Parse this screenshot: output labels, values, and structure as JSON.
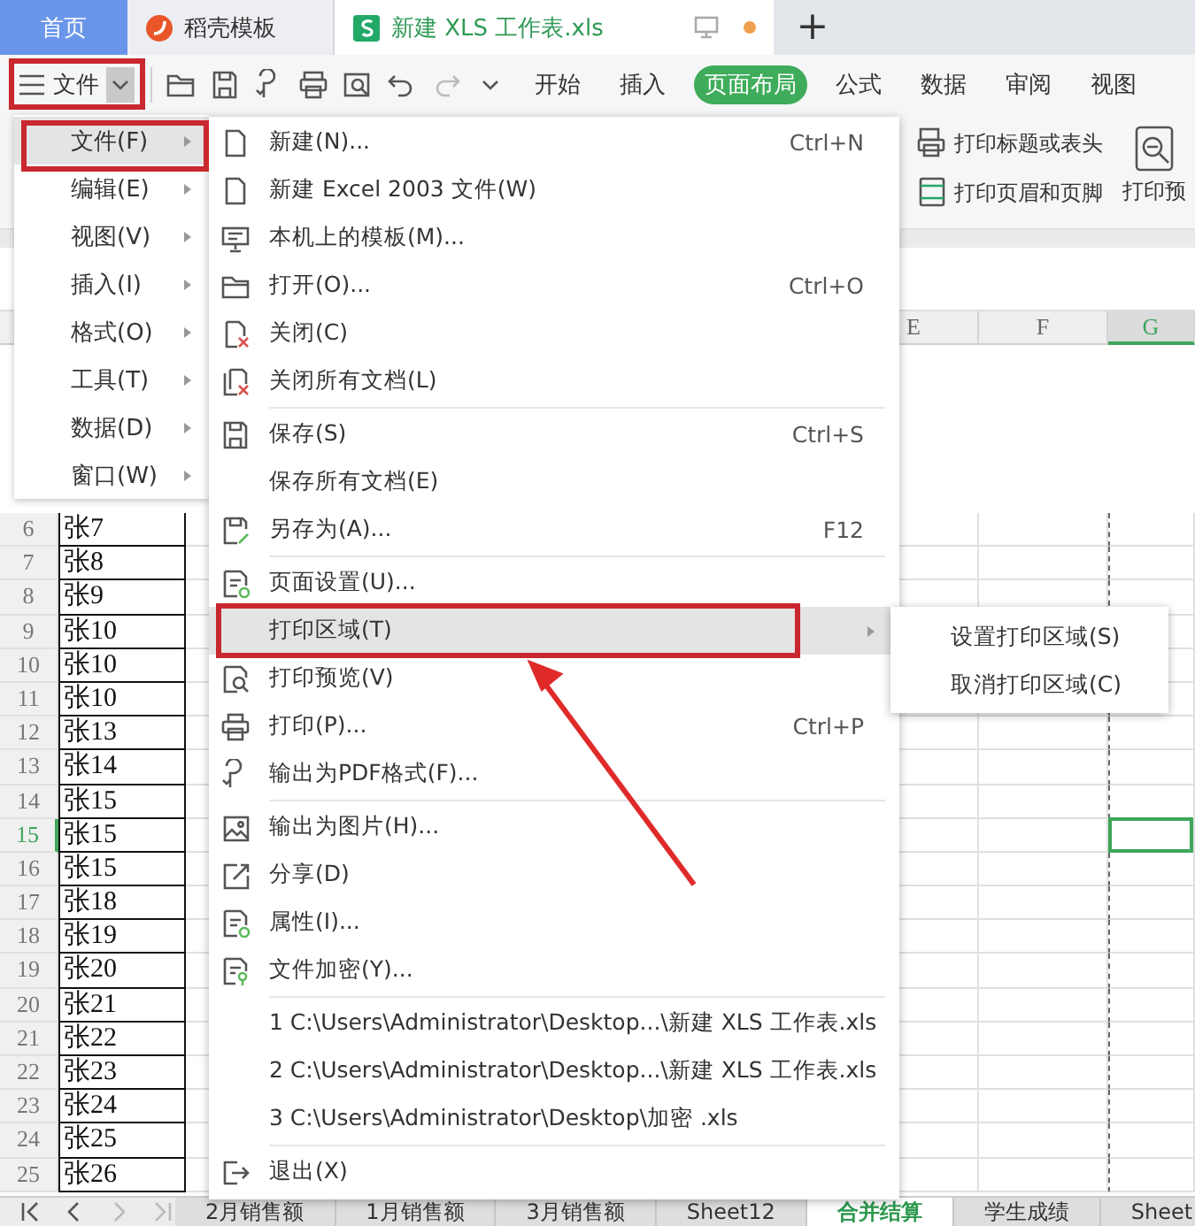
{
  "doc_tabs": [
    {
      "label": "首页",
      "selected": false
    },
    {
      "label": "稻壳模板",
      "selected": false
    },
    {
      "label": "新建 XLS 工作表.xls",
      "selected": true,
      "modified": true
    }
  ],
  "new_tab": "+",
  "file_button": {
    "label": "文件"
  },
  "ribbon_tabs": [
    {
      "label": "开始",
      "selected": false
    },
    {
      "label": "插入",
      "selected": false
    },
    {
      "label": "页面布局",
      "selected": true
    },
    {
      "label": "公式",
      "selected": false
    },
    {
      "label": "数据",
      "selected": false
    },
    {
      "label": "审阅",
      "selected": false
    },
    {
      "label": "视图",
      "selected": false
    }
  ],
  "ribbon": {
    "buttons": [
      {
        "label": "打印标题或表头"
      },
      {
        "label": "打印页眉和页脚"
      }
    ],
    "large_button": {
      "label": "打印预"
    }
  },
  "columns": [
    {
      "label": "E",
      "selected": false
    },
    {
      "label": "F",
      "selected": false
    },
    {
      "label": "G",
      "selected": true
    }
  ],
  "rows": [
    {
      "number": "6",
      "name": "张7",
      "selected": false
    },
    {
      "number": "7",
      "name": "张8",
      "selected": false
    },
    {
      "number": "8",
      "name": "张9",
      "selected": false
    },
    {
      "number": "9",
      "name": "张10",
      "selected": false
    },
    {
      "number": "10",
      "name": "张10",
      "selected": false
    },
    {
      "number": "11",
      "name": "张10",
      "selected": false
    },
    {
      "number": "12",
      "name": "张13",
      "selected": false
    },
    {
      "number": "13",
      "name": "张14",
      "selected": false
    },
    {
      "number": "14",
      "name": "张15",
      "selected": false
    },
    {
      "number": "15",
      "name": "张15",
      "selected": true
    },
    {
      "number": "16",
      "name": "张15",
      "selected": false
    },
    {
      "number": "17",
      "name": "张18",
      "selected": false
    },
    {
      "number": "18",
      "name": "张19",
      "selected": false
    },
    {
      "number": "19",
      "name": "张20",
      "selected": false
    },
    {
      "number": "20",
      "name": "张21",
      "selected": false
    },
    {
      "number": "21",
      "name": "张22",
      "selected": false
    },
    {
      "number": "22",
      "name": "张23",
      "selected": false
    },
    {
      "number": "23",
      "name": "张24",
      "selected": false
    },
    {
      "number": "24",
      "name": "张25",
      "selected": false
    },
    {
      "number": "25",
      "name": "张26",
      "selected": false
    }
  ],
  "sheet_tabs": [
    {
      "label": "2月销售额",
      "selected": false
    },
    {
      "label": "1月销售额",
      "selected": false
    },
    {
      "label": "3月销售额",
      "selected": false
    },
    {
      "label": "Sheet12",
      "selected": false
    },
    {
      "label": "合并结算",
      "selected": true
    },
    {
      "label": "学生成绩",
      "selected": false
    },
    {
      "label": "Sheet",
      "selected": false
    }
  ],
  "left_menu": {
    "items": [
      {
        "label": "文件(F)",
        "selected": true
      },
      {
        "label": "编辑(E)",
        "selected": false
      },
      {
        "label": "视图(V)",
        "selected": false
      },
      {
        "label": "插入(I)",
        "selected": false
      },
      {
        "label": "格式(O)",
        "selected": false
      },
      {
        "label": "工具(T)",
        "selected": false
      },
      {
        "label": "数据(D)",
        "selected": false
      },
      {
        "label": "窗口(W)",
        "selected": false
      }
    ]
  },
  "file_menu": {
    "items": [
      {
        "kind": "command",
        "label": "新建(N)...",
        "shortcut": "Ctrl+N",
        "selected": false
      },
      {
        "kind": "command",
        "label": "新建 Excel 2003 文件(W)",
        "selected": false
      },
      {
        "kind": "command",
        "label": "本机上的模板(M)...",
        "selected": false
      },
      {
        "kind": "command",
        "label": "打开(O)...",
        "shortcut": "Ctrl+O",
        "selected": false
      },
      {
        "kind": "command",
        "label": "关闭(C)",
        "selected": false
      },
      {
        "kind": "command",
        "label": "关闭所有文档(L)",
        "selected": false
      },
      {
        "kind": "separator"
      },
      {
        "kind": "command",
        "label": "保存(S)",
        "shortcut": "Ctrl+S",
        "selected": false
      },
      {
        "kind": "command",
        "label": "保存所有文档(E)",
        "selected": false
      },
      {
        "kind": "command",
        "label": "另存为(A)...",
        "shortcut": "F12",
        "selected": false
      },
      {
        "kind": "separator"
      },
      {
        "kind": "command",
        "label": "页面设置(U)...",
        "selected": false
      },
      {
        "kind": "submenu",
        "label": "打印区域(T)",
        "selected": true
      },
      {
        "kind": "command",
        "label": "打印预览(V)",
        "selected": false
      },
      {
        "kind": "command",
        "label": "打印(P)...",
        "shortcut": "Ctrl+P",
        "selected": false
      },
      {
        "kind": "command",
        "label": "输出为PDF格式(F)...",
        "selected": false
      },
      {
        "kind": "separator"
      },
      {
        "kind": "command",
        "label": "输出为图片(H)...",
        "selected": false
      },
      {
        "kind": "command",
        "label": "分享(D)",
        "selected": false
      },
      {
        "kind": "command",
        "label": "属性(I)...",
        "selected": false
      },
      {
        "kind": "command",
        "label": "文件加密(Y)...",
        "selected": false
      },
      {
        "kind": "separator"
      },
      {
        "kind": "command",
        "label": "1 C:\\Users\\Administrator\\Desktop...\\新建 XLS 工作表.xls",
        "selected": false
      },
      {
        "kind": "command",
        "label": "2 C:\\Users\\Administrator\\Desktop...\\新建 XLS 工作表.xls",
        "selected": false
      },
      {
        "kind": "command",
        "label": "3 C:\\Users\\Administrator\\Desktop\\加密 .xls",
        "selected": false
      },
      {
        "kind": "separator"
      },
      {
        "kind": "command",
        "label": "退出(X)",
        "selected": false
      }
    ]
  },
  "print_area_menu": {
    "items": [
      {
        "label": "设置打印区域(S)"
      },
      {
        "label": "取消打印区域(C)"
      }
    ]
  }
}
